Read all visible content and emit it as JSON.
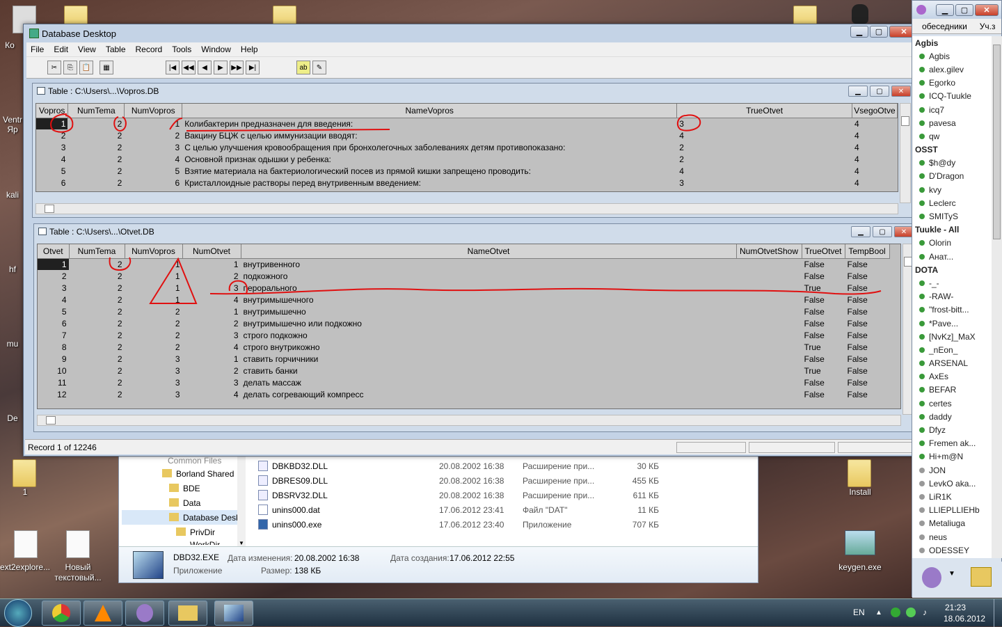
{
  "desktop": {
    "icons_left": [
      "Ко",
      "Ventr\nЯр",
      "kali",
      "hf",
      "mu",
      "De",
      "1",
      "ext2explore...",
      "Новый\nтекстовый..."
    ],
    "icons_right": [
      "Install",
      "keygen.exe"
    ]
  },
  "app": {
    "title": "Database Desktop",
    "menu": [
      "File",
      "Edit",
      "View",
      "Table",
      "Record",
      "Tools",
      "Window",
      "Help"
    ],
    "status": "Record 1 of 12246"
  },
  "table1": {
    "title": "Table : C:\\Users\\...\\Vopros.DB",
    "columns": [
      "Vopros",
      "NumTema",
      "NumVopros",
      "NameVopros",
      "TrueOtvet",
      "VsegoOtve"
    ],
    "rows": [
      [
        "1",
        "2",
        "1",
        "Колибактерин предназначен для введения:",
        "3",
        "4"
      ],
      [
        "2",
        "2",
        "2",
        "Вакцину БЦЖ с целью иммунизации вводят:",
        "4",
        "4"
      ],
      [
        "3",
        "2",
        "3",
        "С целью улучшения кровообращения при бронхолегочных заболеваниях детям противопоказано:",
        "2",
        "4"
      ],
      [
        "4",
        "2",
        "4",
        "Основной признак одышки у ребенка:",
        "2",
        "4"
      ],
      [
        "5",
        "2",
        "5",
        "Взятие материала на бактериологический посев из прямой кишки  запрещено проводить:",
        "4",
        "4"
      ],
      [
        "6",
        "2",
        "6",
        "Кристаллоидные растворы  перед внутривенным введением:",
        "3",
        "4"
      ]
    ]
  },
  "table2": {
    "title": "Table : C:\\Users\\...\\Otvet.DB",
    "columns": [
      "Otvet",
      "NumTema",
      "NumVopros",
      "NumOtvet",
      "NameOtvet",
      "NumOtvetShow",
      "TrueOtvet",
      "TempBool"
    ],
    "rows": [
      [
        "1",
        "2",
        "1",
        "1",
        "внутривенного",
        "",
        "False",
        "False"
      ],
      [
        "2",
        "2",
        "1",
        "2",
        "подкожного",
        "",
        "False",
        "False"
      ],
      [
        "3",
        "2",
        "1",
        "3",
        "перорального",
        "",
        "True",
        "False"
      ],
      [
        "4",
        "2",
        "1",
        "4",
        "внутримышечного",
        "",
        "False",
        "False"
      ],
      [
        "5",
        "2",
        "2",
        "1",
        "внутримышечно",
        "",
        "False",
        "False"
      ],
      [
        "6",
        "2",
        "2",
        "2",
        "внутримышечно или подкожно",
        "",
        "False",
        "False"
      ],
      [
        "7",
        "2",
        "2",
        "3",
        "строго подкожно",
        "",
        "False",
        "False"
      ],
      [
        "8",
        "2",
        "2",
        "4",
        "строго внутрикожно",
        "",
        "True",
        "False"
      ],
      [
        "9",
        "2",
        "3",
        "1",
        "ставить горчичники",
        "",
        "False",
        "False"
      ],
      [
        "10",
        "2",
        "3",
        "2",
        "ставить банки",
        "",
        "True",
        "False"
      ],
      [
        "11",
        "2",
        "3",
        "3",
        "делать массаж",
        "",
        "False",
        "False"
      ],
      [
        "12",
        "2",
        "3",
        "4",
        "делать согревающий компресс",
        "",
        "False",
        "False"
      ]
    ]
  },
  "explorer": {
    "tree": [
      "Common Files",
      "Borland Shared",
      "BDE",
      "Data",
      "Database Desk",
      "PrivDir",
      "WorkDir"
    ],
    "files": [
      {
        "name": "DBKBD32.DLL",
        "date": "20.08.2002 16:38",
        "type": "Расширение при...",
        "size": "30 КБ"
      },
      {
        "name": "DBRES09.DLL",
        "date": "20.08.2002 16:38",
        "type": "Расширение при...",
        "size": "455 КБ"
      },
      {
        "name": "DBSRV32.DLL",
        "date": "20.08.2002 16:38",
        "type": "Расширение при...",
        "size": "611 КБ"
      },
      {
        "name": "unins000.dat",
        "date": "17.06.2012 23:41",
        "type": "Файл \"DAT\"",
        "size": "11 КБ"
      },
      {
        "name": "unins000.exe",
        "date": "17.06.2012 23:40",
        "type": "Приложение",
        "size": "707 КБ"
      }
    ],
    "details": {
      "name": "DBD32.EXE",
      "modified_label": "Дата изменения:",
      "modified": "20.08.2002 16:38",
      "created_label": "Дата создания:",
      "created": "17.06.2012 22:55",
      "kind": "Приложение",
      "size_label": "Размер:",
      "size": "138 КБ"
    }
  },
  "contacts": {
    "tabs": [
      "обеседники",
      "Уч.з"
    ],
    "items": [
      {
        "label": "Agbis",
        "group": true
      },
      {
        "label": "Agbis"
      },
      {
        "label": "alex.gilev"
      },
      {
        "label": "Egorko"
      },
      {
        "label": "ICQ-Tuukle"
      },
      {
        "label": "icq7"
      },
      {
        "label": "pavesa"
      },
      {
        "label": "qw"
      },
      {
        "label": "OSST",
        "group": true
      },
      {
        "label": "$h@dy"
      },
      {
        "label": "D'Dragon"
      },
      {
        "label": "kvy"
      },
      {
        "label": "Leclerc"
      },
      {
        "label": "SMITyS"
      },
      {
        "label": "Tuukle - All",
        "group": true
      },
      {
        "label": "Olorin"
      },
      {
        "label": "Анат..."
      },
      {
        "label": "DOTA",
        "group": true
      },
      {
        "label": "-_-"
      },
      {
        "label": "-RAW-"
      },
      {
        "label": "\"frost-bitt..."
      },
      {
        "label": "*Pave..."
      },
      {
        "label": "[NvKz]_MaX"
      },
      {
        "label": "_nEon_"
      },
      {
        "label": "ARSENAL"
      },
      {
        "label": "AxEs"
      },
      {
        "label": "BEFAR"
      },
      {
        "label": "certes"
      },
      {
        "label": "daddy"
      },
      {
        "label": "Dfyz"
      },
      {
        "label": "Fremen ak..."
      },
      {
        "label": "Hi+m@N"
      },
      {
        "label": "JON"
      },
      {
        "label": "LevkO aka..."
      },
      {
        "label": "LiR1K"
      },
      {
        "label": "LLIEPLLIEHb"
      },
      {
        "label": "Metaliuga"
      },
      {
        "label": "neus"
      },
      {
        "label": "ODESSEY"
      }
    ]
  },
  "tray": {
    "lang": "EN",
    "time": "21:23",
    "date": "18.06.2012"
  }
}
